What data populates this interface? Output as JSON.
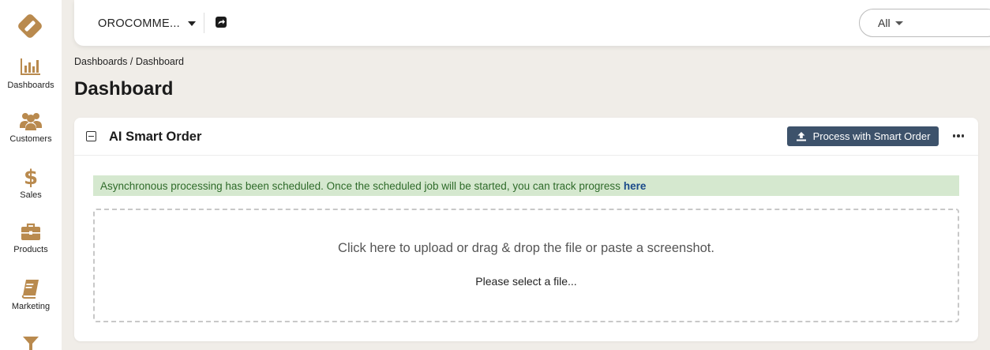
{
  "sidebar": {
    "items": [
      {
        "label": "Dashboards",
        "icon": "bar-chart-icon"
      },
      {
        "label": "Customers",
        "icon": "users-icon"
      },
      {
        "label": "Sales",
        "icon": "dollar-icon"
      },
      {
        "label": "Products",
        "icon": "briefcase-icon"
      },
      {
        "label": "Marketing",
        "icon": "book-icon"
      },
      {
        "label": "",
        "icon": "filter-icon"
      }
    ],
    "accent": "#b98a4e"
  },
  "topbar": {
    "organization": "OROCOMME...",
    "scope": "All"
  },
  "breadcrumb": {
    "parent": "Dashboards",
    "separator": " / ",
    "current": "Dashboard"
  },
  "page_title": "Dashboard",
  "widget": {
    "title": "AI Smart Order",
    "process_button": "Process with Smart Order",
    "alert_text": "Asynchronous processing has been scheduled. Once the scheduled job will be started, you can track progress",
    "alert_link": "here",
    "dropzone_text": "Click here to upload or drag & drop the file or paste a screenshot.",
    "dropzone_subtext": "Please select a file..."
  },
  "colors": {
    "button_bg": "#3d526b",
    "alert_bg": "#d5e8cf",
    "alert_text": "#2f6b2a",
    "page_bg": "#f0ede8"
  }
}
